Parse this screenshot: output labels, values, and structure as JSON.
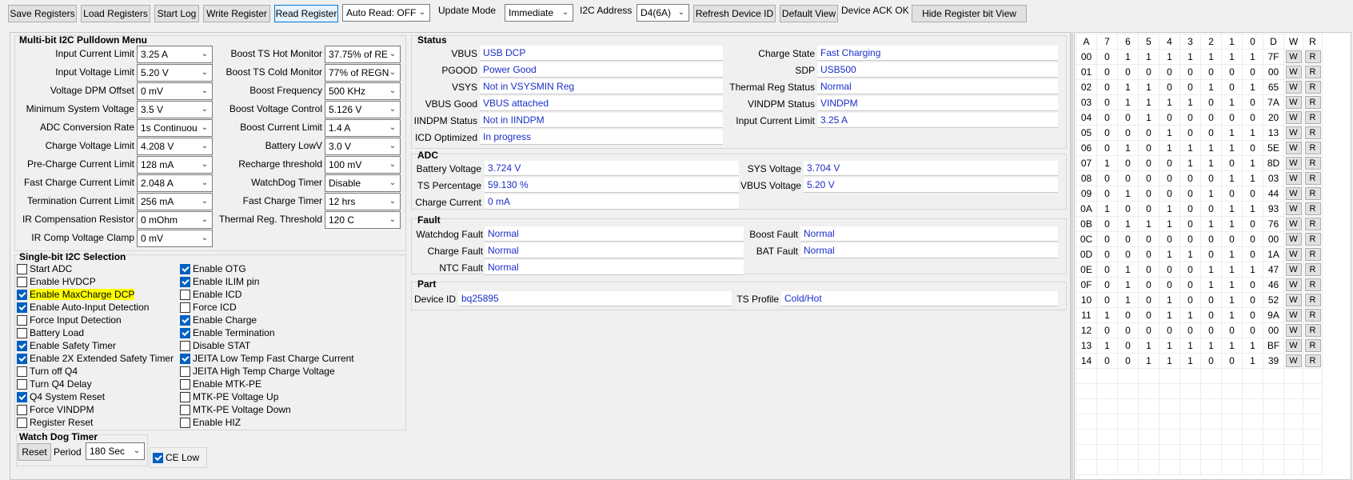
{
  "toolbar": {
    "save": "Save Registers",
    "load": "Load Registers",
    "startlog": "Start Log",
    "write": "Write Register",
    "read": "Read Register",
    "autoread": "Auto Read: OFF",
    "update_mode_label": "Update Mode",
    "update_mode": "Immediate",
    "i2c_label": "I2C Address",
    "i2c": "D4(6A)",
    "refresh": "Refresh Device ID",
    "default": "Default View",
    "ack": "Device ACK OK",
    "hide": "Hide Register bit View"
  },
  "multibit": {
    "title": "Multi-bit I2C Pulldown Menu",
    "left": [
      {
        "label": "Input Current Limit",
        "value": "3.25 A"
      },
      {
        "label": "Input Voltage Limit",
        "value": "5.20 V"
      },
      {
        "label": "Voltage DPM Offset",
        "value": "0 mV"
      },
      {
        "label": "Minimum System Voltage",
        "value": "3.5 V"
      },
      {
        "label": "ADC Conversion Rate",
        "value": "1s Continuou"
      },
      {
        "label": "Charge Voltage Limit",
        "value": "4.208 V"
      },
      {
        "label": "Pre-Charge Current Limit",
        "value": "128 mA"
      },
      {
        "label": "Fast Charge Current Limit",
        "value": "2.048 A"
      },
      {
        "label": "Termination Current Limit",
        "value": "256 mA"
      },
      {
        "label": "IR Compensation Resistor",
        "value": "0 mOhm"
      },
      {
        "label": "IR Comp Voltage Clamp",
        "value": "0 mV"
      }
    ],
    "right": [
      {
        "label": "Boost TS Hot Monitor",
        "value": "37.75% of RE"
      },
      {
        "label": "Boost TS Cold Monitor",
        "value": "77% of REGN"
      },
      {
        "label": "Boost Frequency",
        "value": "500 KHz"
      },
      {
        "label": "Boost Voltage Control",
        "value": "5.126 V"
      },
      {
        "label": "Boost Current Limit",
        "value": "1.4 A"
      },
      {
        "label": "Battery LowV",
        "value": "3.0 V"
      },
      {
        "label": "Recharge threshold",
        "value": "100 mV"
      },
      {
        "label": "WatchDog Timer",
        "value": "Disable"
      },
      {
        "label": "Fast Charge Timer",
        "value": "12 hrs"
      },
      {
        "label": "Thermal Reg. Threshold",
        "value": "120 C"
      }
    ]
  },
  "singlebit": {
    "title": "Single-bit I2C Selection",
    "left": [
      {
        "label": "Start ADC",
        "checked": false
      },
      {
        "label": "Enable HVDCP",
        "checked": false
      },
      {
        "label": "Enable MaxCharge DCP",
        "checked": true,
        "highlight": true
      },
      {
        "label": "Enable Auto-Input Detection",
        "checked": true
      },
      {
        "label": "Force Input Detection",
        "checked": false
      },
      {
        "label": "Battery Load",
        "checked": false
      },
      {
        "label": "Enable Safety Timer",
        "checked": true
      },
      {
        "label": "Enable 2X Extended Safety Timer",
        "checked": true
      },
      {
        "label": "Turn off Q4",
        "checked": false
      },
      {
        "label": "Turn Q4 Delay",
        "checked": false
      },
      {
        "label": "Q4 System Reset",
        "checked": true
      },
      {
        "label": "Force VINDPM",
        "checked": false
      },
      {
        "label": "Register Reset",
        "checked": false
      }
    ],
    "right": [
      {
        "label": "Enable OTG",
        "checked": true
      },
      {
        "label": "Enable ILIM pin",
        "checked": true
      },
      {
        "label": "Enable ICD",
        "checked": false
      },
      {
        "label": "Force ICD",
        "checked": false
      },
      {
        "label": "Enable Charge",
        "checked": true
      },
      {
        "label": "Enable Termination",
        "checked": true
      },
      {
        "label": "Disable STAT",
        "checked": false
      },
      {
        "label": "JEITA Low Temp Fast Charge Current",
        "checked": true
      },
      {
        "label": "JEITA High Temp Charge Voltage",
        "checked": false
      },
      {
        "label": "Enable MTK-PE",
        "checked": false
      },
      {
        "label": "MTK-PE Voltage Up",
        "checked": false
      },
      {
        "label": "MTK-PE Voltage Down",
        "checked": false
      },
      {
        "label": "Enable HIZ",
        "checked": false
      }
    ]
  },
  "watchdog": {
    "title": "Watch Dog Timer",
    "reset": "Reset",
    "period_label": "Period",
    "period": "180 Sec",
    "celow": "CE Low",
    "celow_checked": true
  },
  "status": {
    "title": "Status",
    "left": [
      {
        "label": "VBUS",
        "value": "USB DCP"
      },
      {
        "label": "PGOOD",
        "value": "Power Good"
      },
      {
        "label": "VSYS",
        "value": "Not in VSYSMIN Reg"
      },
      {
        "label": "VBUS Good",
        "value": "VBUS attached"
      },
      {
        "label": "IINDPM Status",
        "value": "Not in IINDPM"
      },
      {
        "label": "ICD Optimized",
        "value": "In progress"
      }
    ],
    "right": [
      {
        "label": "Charge State",
        "value": "Fast Charging"
      },
      {
        "label": "SDP",
        "value": "USB500"
      },
      {
        "label": "Thermal Reg Status",
        "value": "Normal"
      },
      {
        "label": "VINDPM Status",
        "value": "VINDPM"
      },
      {
        "label": "Input Current Limit",
        "value": "3.25 A"
      }
    ]
  },
  "adc": {
    "title": "ADC",
    "left": [
      {
        "label": "Battery Voltage",
        "value": "3.724 V"
      },
      {
        "label": "TS Percentage",
        "value": "59.130 %"
      },
      {
        "label": "Charge Current",
        "value": "0 mA"
      }
    ],
    "right": [
      {
        "label": "SYS Voltage",
        "value": "3.704 V"
      },
      {
        "label": "VBUS Voltage",
        "value": "5.20 V"
      }
    ]
  },
  "fault": {
    "title": "Fault",
    "left": [
      {
        "label": "Watchdog Fault",
        "value": "Normal"
      },
      {
        "label": "Charge Fault",
        "value": "Normal"
      },
      {
        "label": "NTC Fault",
        "value": "Normal"
      }
    ],
    "right": [
      {
        "label": "Boost Fault",
        "value": "Normal"
      },
      {
        "label": "BAT Fault",
        "value": "Normal"
      }
    ]
  },
  "part": {
    "title": "Part",
    "device_label": "Device ID",
    "device": "bq25895",
    "ts_label": "TS Profile",
    "ts": "Cold/Hot"
  },
  "registers": {
    "headers": [
      "A",
      "7",
      "6",
      "5",
      "4",
      "3",
      "2",
      "1",
      "0",
      "D",
      "W",
      "R"
    ],
    "write_label": "W",
    "read_label": "R",
    "rows": [
      [
        "00",
        "0",
        "1",
        "1",
        "1",
        "1",
        "1",
        "1",
        "1",
        "7F"
      ],
      [
        "01",
        "0",
        "0",
        "0",
        "0",
        "0",
        "0",
        "0",
        "0",
        "00"
      ],
      [
        "02",
        "0",
        "1",
        "1",
        "0",
        "0",
        "1",
        "0",
        "1",
        "65"
      ],
      [
        "03",
        "0",
        "1",
        "1",
        "1",
        "1",
        "0",
        "1",
        "0",
        "7A"
      ],
      [
        "04",
        "0",
        "0",
        "1",
        "0",
        "0",
        "0",
        "0",
        "0",
        "20"
      ],
      [
        "05",
        "0",
        "0",
        "0",
        "1",
        "0",
        "0",
        "1",
        "1",
        "13"
      ],
      [
        "06",
        "0",
        "1",
        "0",
        "1",
        "1",
        "1",
        "1",
        "0",
        "5E"
      ],
      [
        "07",
        "1",
        "0",
        "0",
        "0",
        "1",
        "1",
        "0",
        "1",
        "8D"
      ],
      [
        "08",
        "0",
        "0",
        "0",
        "0",
        "0",
        "0",
        "1",
        "1",
        "03"
      ],
      [
        "09",
        "0",
        "1",
        "0",
        "0",
        "0",
        "1",
        "0",
        "0",
        "44"
      ],
      [
        "0A",
        "1",
        "0",
        "0",
        "1",
        "0",
        "0",
        "1",
        "1",
        "93"
      ],
      [
        "0B",
        "0",
        "1",
        "1",
        "1",
        "0",
        "1",
        "1",
        "0",
        "76"
      ],
      [
        "0C",
        "0",
        "0",
        "0",
        "0",
        "0",
        "0",
        "0",
        "0",
        "00"
      ],
      [
        "0D",
        "0",
        "0",
        "0",
        "1",
        "1",
        "0",
        "1",
        "0",
        "1A"
      ],
      [
        "0E",
        "0",
        "1",
        "0",
        "0",
        "0",
        "1",
        "1",
        "1",
        "47"
      ],
      [
        "0F",
        "0",
        "1",
        "0",
        "0",
        "0",
        "1",
        "1",
        "0",
        "46"
      ],
      [
        "10",
        "0",
        "1",
        "0",
        "1",
        "0",
        "0",
        "1",
        "0",
        "52"
      ],
      [
        "11",
        "1",
        "0",
        "0",
        "1",
        "1",
        "0",
        "1",
        "0",
        "9A"
      ],
      [
        "12",
        "0",
        "0",
        "0",
        "0",
        "0",
        "0",
        "0",
        "0",
        "00"
      ],
      [
        "13",
        "1",
        "0",
        "1",
        "1",
        "1",
        "1",
        "1",
        "1",
        "BF"
      ],
      [
        "14",
        "0",
        "0",
        "1",
        "1",
        "1",
        "0",
        "0",
        "1",
        "39"
      ]
    ]
  }
}
